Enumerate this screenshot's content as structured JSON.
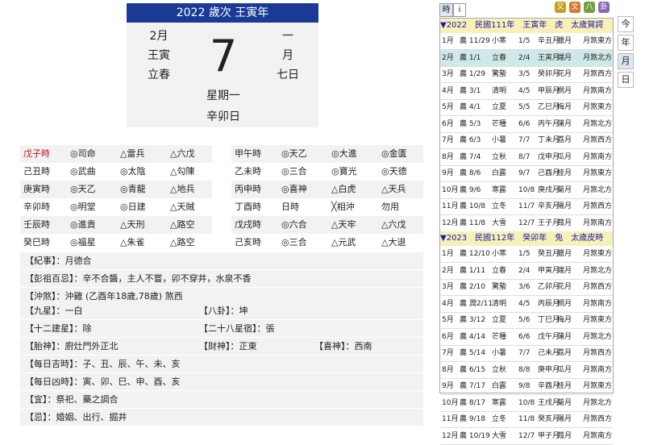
{
  "header": {
    "title": "2022 歲次 王寅年"
  },
  "date": {
    "month": "2月",
    "lunar_left": "王寅",
    "term": "立春",
    "day": "7",
    "lunar_right_1": "一",
    "lunar_right_2": "月",
    "lunar_right_3": "七日",
    "weekday": "星期一",
    "ganzhi": "辛卯日"
  },
  "hours": [
    {
      "cells": [
        "戊子時",
        "◎司命",
        "△雷兵",
        "△六戊"
      ]
    },
    {
      "cells": [
        "己丑時",
        "◎武曲",
        "◎太陰",
        "△勾陳"
      ]
    },
    {
      "cells": [
        "庚寅時",
        "◎天乙",
        "◎青龍",
        "△地兵"
      ]
    },
    {
      "cells": [
        "辛卯時",
        "◎明堂",
        "◎日建",
        "△天賊"
      ]
    },
    {
      "cells": [
        "壬辰時",
        "◎進貴",
        "△天刑",
        "△路空"
      ]
    },
    {
      "cells": [
        "癸巳時",
        "◎福星",
        "△朱雀",
        "△路空"
      ]
    },
    {
      "cells": [
        "甲午時",
        "◎天乙",
        "◎大進",
        "◎金匱"
      ]
    },
    {
      "cells": [
        "乙未時",
        "◎三合",
        "◎寶光",
        "◎天德"
      ]
    },
    {
      "cells": [
        "丙申時",
        "◎喜神",
        "△白虎",
        "△天兵"
      ]
    },
    {
      "cells": [
        "丁酉時",
        "日時",
        "╳相沖",
        "勿用"
      ]
    },
    {
      "cells": [
        "戊戌時",
        "◎六合",
        "△天牢",
        "△六戊"
      ]
    },
    {
      "cells": [
        "己亥時",
        "◎三合",
        "△元武",
        "△大退"
      ]
    }
  ],
  "info": {
    "jishi": "【紀事】：月德合",
    "pengzu": "【彭祖百忌】：辛不合醬，主人不嘗，卯不穿井，水泉不香",
    "chongsha": "【沖煞】：沖雞 (乙酉年18歲,78歲) 煞西",
    "jiuxing": "【九星】：一白",
    "bagua": "【八卦】：坤",
    "jianxing": "【十二建星】：除",
    "xiusu": "【二十八星宿】：張",
    "taishen": "【胎神】：廚灶門外正北",
    "caishen": "【財神】：正東",
    "xishen": "【喜神】：西南",
    "jishi_hours": "【每日吉時】：子、丑、辰、午、未、亥",
    "xiongshi_hours": "【每日凶時】：寅、卯、巳、申、酉、亥",
    "yi": "【宜】：祭祀、藥之調合",
    "ji": "【忌】：婚姻、出行、掘井"
  },
  "tabs": {
    "shi": "時",
    "info": "i"
  },
  "icons": [
    {
      "name": "icon-1",
      "color": "#c8a020",
      "glyph": "又"
    },
    {
      "name": "icon-2",
      "color": "#d87830",
      "glyph": "文"
    },
    {
      "name": "icon-3",
      "color": "#70a040",
      "glyph": "八"
    },
    {
      "name": "icon-4",
      "color": "#8a6ab0",
      "glyph": "卦"
    }
  ],
  "side": {
    "today": "今",
    "year": "年",
    "month": "月",
    "day": "日"
  },
  "calendar": {
    "years": [
      {
        "header": "▼2022　民國111年　王寅年　虎　太歲賀諤",
        "months": [
          [
            "1月",
            "農 11/29",
            "小寒",
            "1/5",
            "辛丑月",
            "臘月",
            "月煞東方"
          ],
          [
            "2月",
            "農 1/1",
            "立春",
            "2/4",
            "王寅月",
            "端月",
            "月煞北方"
          ],
          [
            "3月",
            "農 1/29",
            "驚蟄",
            "3/5",
            "癸卯月",
            "花月",
            "月煞西方"
          ],
          [
            "4月",
            "農 3/1",
            "清明",
            "4/5",
            "甲辰月",
            "桐月",
            "月煞南方"
          ],
          [
            "5月",
            "農 4/1",
            "立夏",
            "5/5",
            "乙巳月",
            "梅月",
            "月煞東方"
          ],
          [
            "6月",
            "農 5/3",
            "芒種",
            "6/6",
            "丙午月",
            "蒲月",
            "月煞北方"
          ],
          [
            "7月",
            "農 6/3",
            "小暑",
            "7/7",
            "丁未月",
            "荔月",
            "月煞西方"
          ],
          [
            "8月",
            "農 7/4",
            "立秋",
            "8/7",
            "戊申月",
            "瓜月",
            "月煞南方"
          ],
          [
            "9月",
            "農 8/6",
            "白露",
            "9/7",
            "己酉月",
            "桂月",
            "月煞東方"
          ],
          [
            "10月",
            "農 9/6",
            "寒露",
            "10/8",
            "庚戌月",
            "菊月",
            "月煞北方"
          ],
          [
            "11月",
            "農 10/8",
            "立冬",
            "11/7",
            "辛亥月",
            "陽月",
            "月煞西方"
          ],
          [
            "12月",
            "農 11/8",
            "大雪",
            "12/7",
            "王子月",
            "葭月",
            "月煞南方"
          ]
        ]
      },
      {
        "header": "▼2023　民國112年　癸卯年　兔　太歲皮時",
        "months": [
          [
            "1月",
            "農 12/10",
            "小寒",
            "1/5",
            "癸丑月",
            "臘月",
            "月煞東方"
          ],
          [
            "2月",
            "農 1/11",
            "立春",
            "2/4",
            "甲寅月",
            "端月",
            "月煞北方"
          ],
          [
            "3月",
            "農 2/10",
            "驚蟄",
            "3/6",
            "乙卯月",
            "花月",
            "月煞西方"
          ],
          [
            "4月",
            "農 潤2/11",
            "清明",
            "4/5",
            "丙辰月",
            "桐月",
            "月煞南方"
          ],
          [
            "5月",
            "農 3/12",
            "立夏",
            "5/6",
            "丁巳月",
            "梅月",
            "月煞東方"
          ],
          [
            "6月",
            "農 4/14",
            "芒種",
            "6/6",
            "戊午月",
            "蒲月",
            "月煞北方"
          ],
          [
            "7月",
            "農 5/14",
            "小暑",
            "7/7",
            "己未月",
            "荔月",
            "月煞西方"
          ],
          [
            "8月",
            "農 6/15",
            "立秋",
            "8/8",
            "庚申月",
            "瓜月",
            "月煞南方"
          ],
          [
            "9月",
            "農 7/17",
            "白露",
            "9/8",
            "辛酉月",
            "桂月",
            "月煞東方"
          ],
          [
            "10月",
            "農 8/17",
            "寒露",
            "10/8",
            "王戌月",
            "菊月",
            "月煞北方"
          ],
          [
            "11月",
            "農 9/18",
            "立冬",
            "11/8",
            "癸亥月",
            "陽月",
            "月煞西方"
          ],
          [
            "12月",
            "農 10/19",
            "大雪",
            "12/7",
            "甲子月",
            "葭月",
            "月煞南方"
          ]
        ]
      }
    ],
    "highlight": {
      "year": 0,
      "month": 1,
      "color": "#cfe8e8"
    }
  }
}
